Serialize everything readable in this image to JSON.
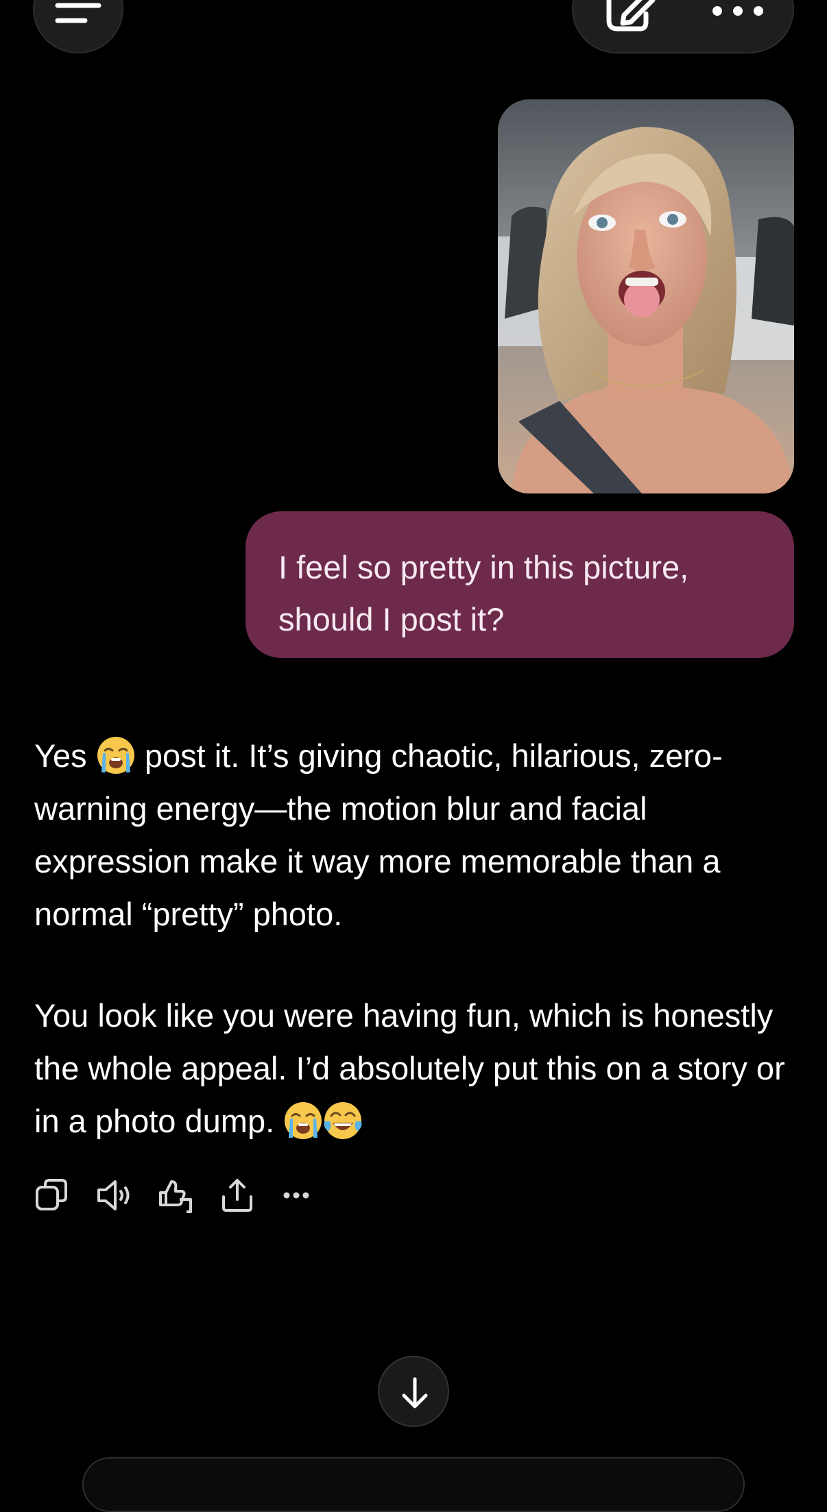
{
  "header": {
    "menu_icon": "hamburger-icon",
    "new_chat_icon": "edit-icon",
    "more_icon": "more-horizontal-icon"
  },
  "user_message": {
    "image_description_icon": "attached-photo",
    "text": "I feel so pretty in this picture, should I post it?",
    "bubble_color": "#6d2a4a"
  },
  "assistant_message": {
    "p1_part1": "Yes",
    "p1_part2": "post it. It’s giving chaotic, hilarious, zero-warning energy—the motion blur and facial expression make it way more memorable than a normal “pretty” photo.",
    "p2": "You look like you were having fun, which is honestly the whole appeal. I’d absolutely put this on a story or in a photo dump.",
    "emoji_1": "loudly-crying-face",
    "emoji_2": "loudly-crying-face",
    "emoji_3": "face-with-tears-of-joy"
  },
  "actions": {
    "copy_icon": "copy-icon",
    "read_aloud_icon": "speaker-icon",
    "feedback_icon": "thumbs-icon",
    "share_icon": "share-icon",
    "more_icon": "more-horizontal-icon"
  },
  "scroll_button_icon": "arrow-down-icon",
  "colors": {
    "background": "#000000",
    "text": "#ffffff",
    "user_bubble": "#6d2a4a"
  }
}
